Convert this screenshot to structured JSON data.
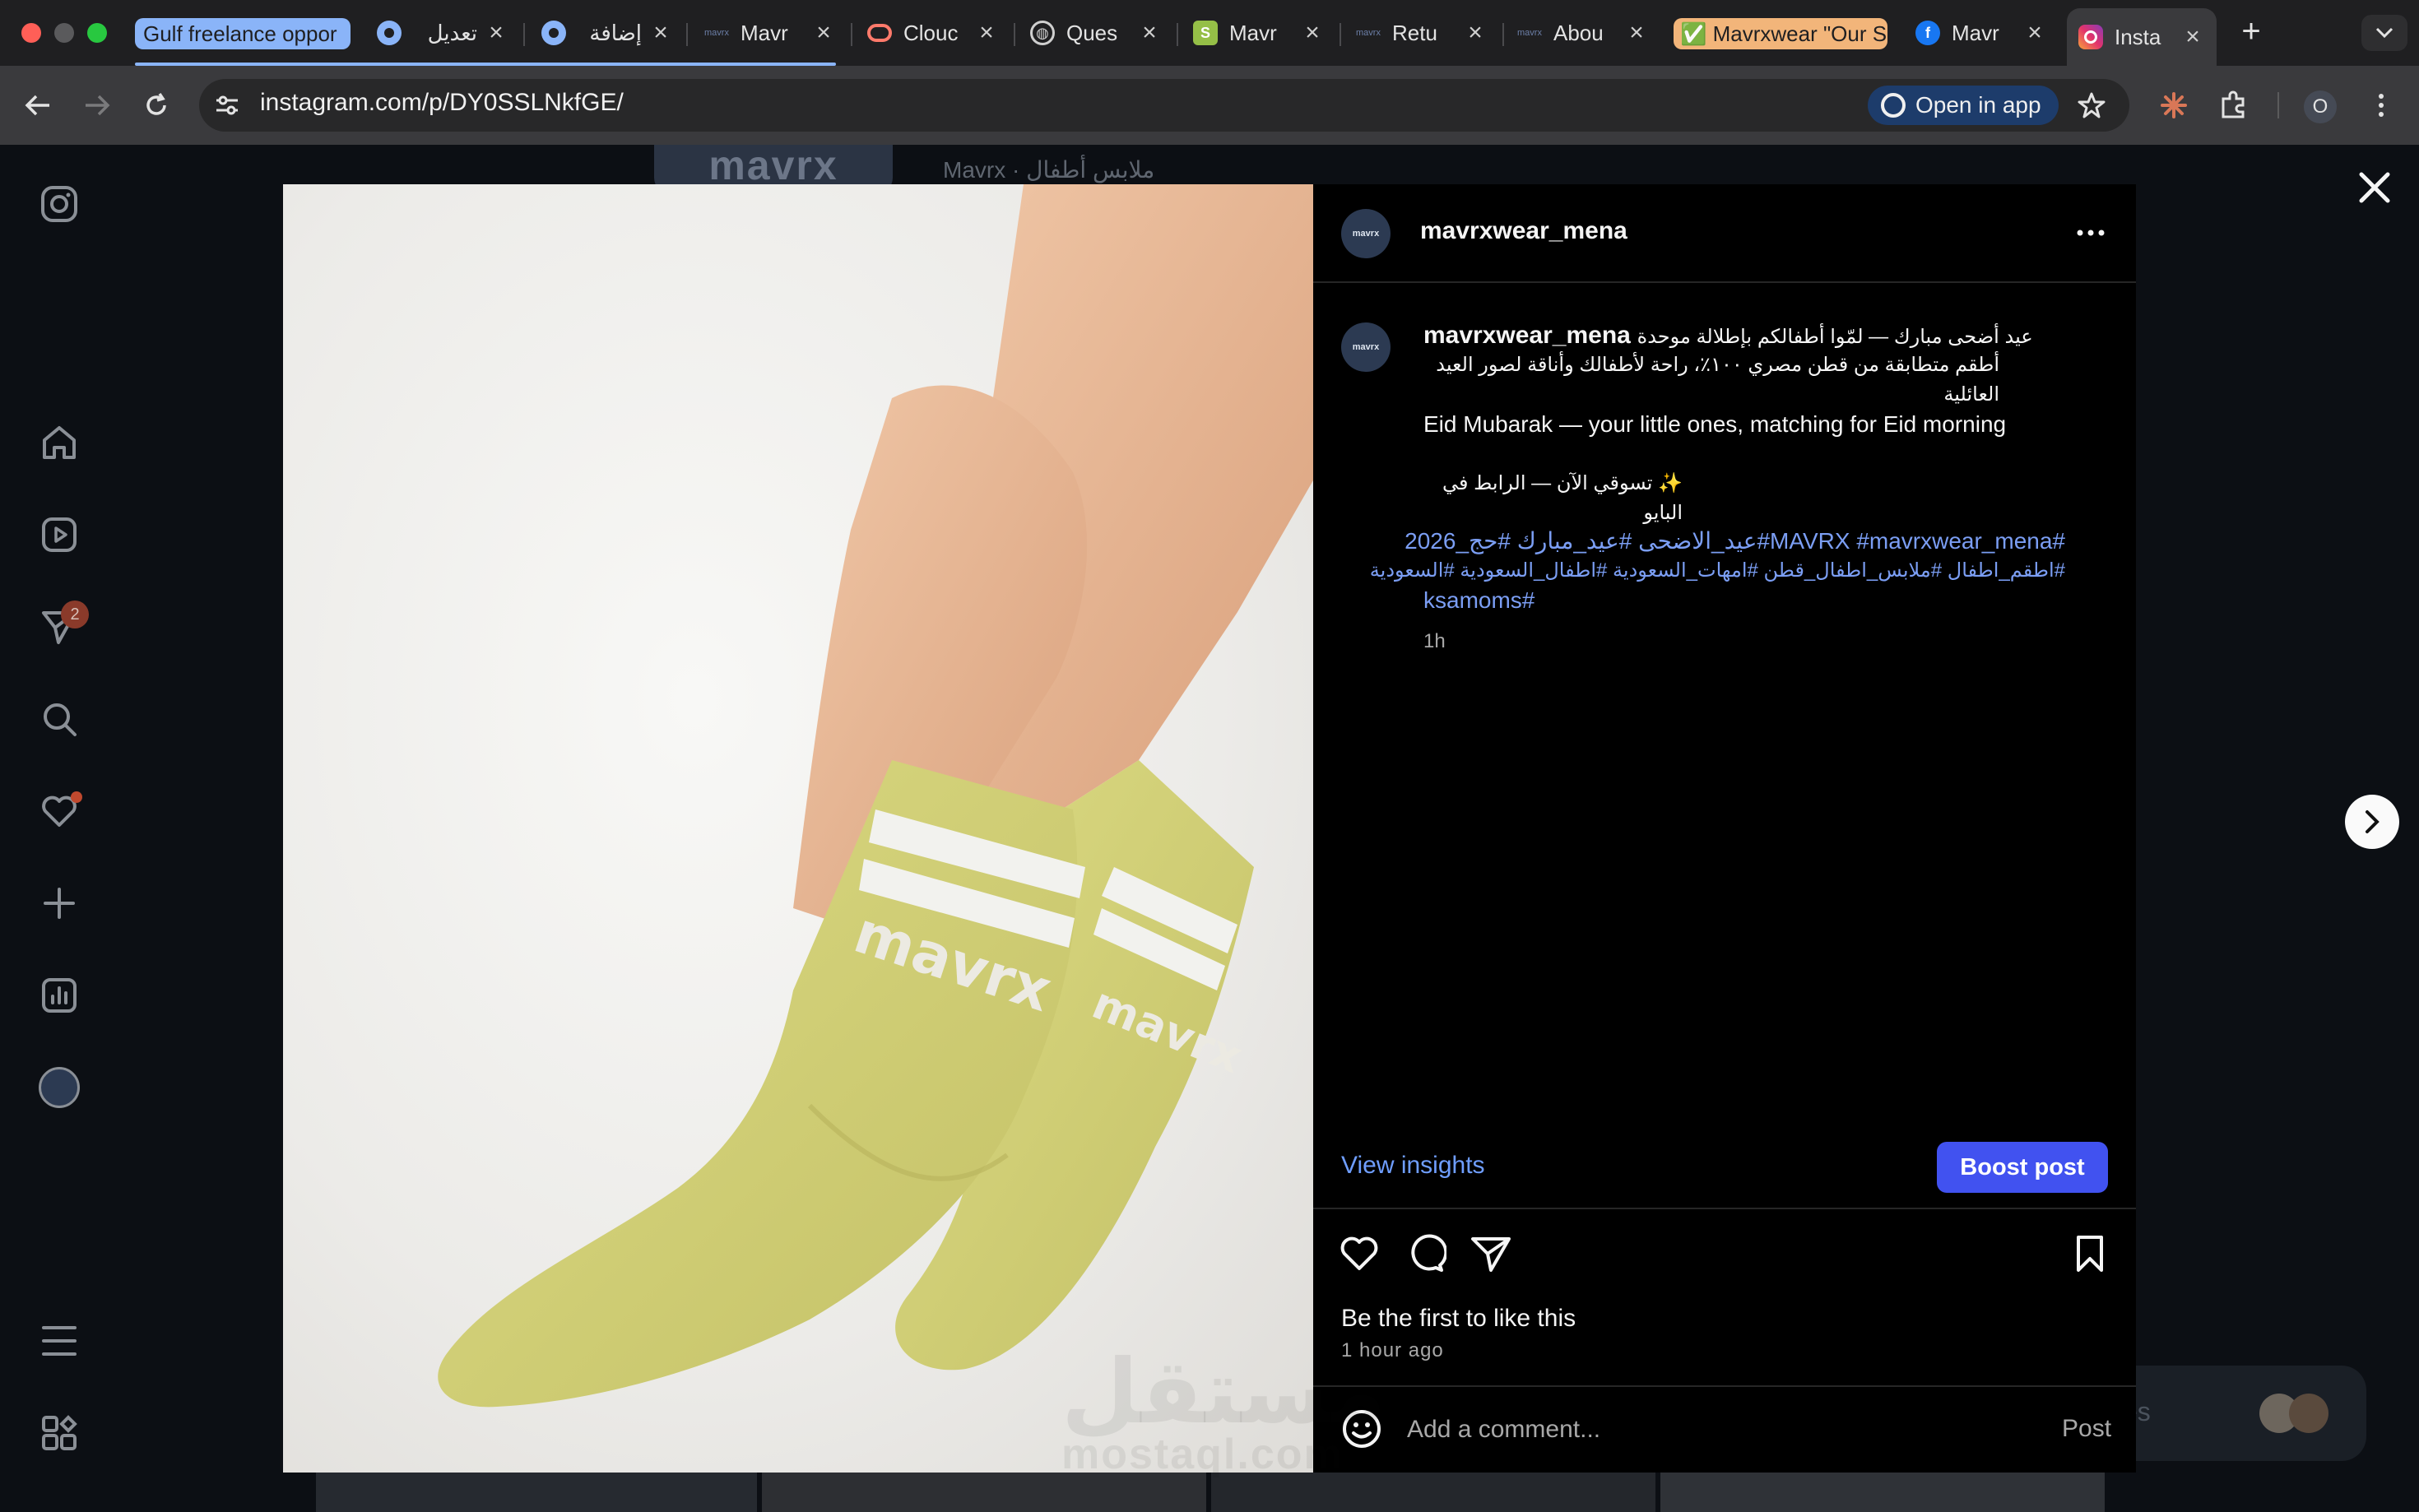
{
  "browser": {
    "tabs": [
      {
        "label": "Gulf freelance oppor",
        "icon": "tab-group-chip",
        "color": "#8ab4f8"
      },
      {
        "label": "تعديل",
        "icon": "circle-o-icon"
      },
      {
        "label": "إضافة",
        "icon": "circle-o-icon"
      },
      {
        "label": "Mavr",
        "icon": "mavrx-icon"
      },
      {
        "label": "Clouc",
        "icon": "cloud-icon"
      },
      {
        "label": "Ques",
        "icon": "globe-icon"
      },
      {
        "label": "Mavr",
        "icon": "shopify-icon"
      },
      {
        "label": "Retu",
        "icon": "mavrx-icon"
      },
      {
        "label": "Abou",
        "icon": "mavrx-icon"
      },
      {
        "label": "✅ Mavrxwear \"Our S",
        "icon": "check-icon",
        "color": "#f2b57a"
      },
      {
        "label": "Mavr",
        "icon": "facebook-icon"
      },
      {
        "label": "Insta",
        "icon": "instagram-icon"
      }
    ],
    "url": "instagram.com/p/DY0SSLNkfGE/",
    "open_in_app": "Open in app",
    "profile_badge": "O"
  },
  "sidebar": {
    "notification_count": "2"
  },
  "background": {
    "logo": "mavrx",
    "profile_name": "Mavrx · ملابس أطفال",
    "card_text": "es"
  },
  "post": {
    "header_username": "mavrxwear_mena",
    "avatar_text": "mavrx",
    "caption_username": "mavrxwear_mena",
    "caption_line1": "عيد أضحى مبارك — لمّوا أطفالكم بإطلالة موحدة",
    "caption_line2": "أطقم متطابقة من قطن مصري ١٠٠٪، راحة لأطفالك وأناقة لصور العيد العائلية",
    "caption_english": "Eid Mubarak — your little ones, matching for Eid morning",
    "caption_cta": "✨ تسوقي الآن — الرابط في البايو",
    "hashtags_line1": "#MAVRX #mavrxwear_mena#عيد_الاضحى #عيد_مبارك #حج_2026",
    "hashtags_line2": "#اطقم_اطفال #ملابس_اطفال_قطن #امهات_السعودية #اطفال_السعودية #السعودية",
    "hashtags_line3": "ksamoms#",
    "caption_time": "1h",
    "view_insights": "View insights",
    "boost_post": "Boost post",
    "likes_text": "Be the first to like this",
    "time_ago": "1 hour ago",
    "comment_placeholder": "Add a comment...",
    "post_label": "Post",
    "sock_brand": "mavrx"
  },
  "watermark": {
    "arabic": "مستقل",
    "latin": "mostaql.com"
  },
  "colors": {
    "accent": "#4152f0",
    "link": "#6f9eff",
    "hashtag": "#7b9ef4",
    "sock": "#d7d57b"
  }
}
